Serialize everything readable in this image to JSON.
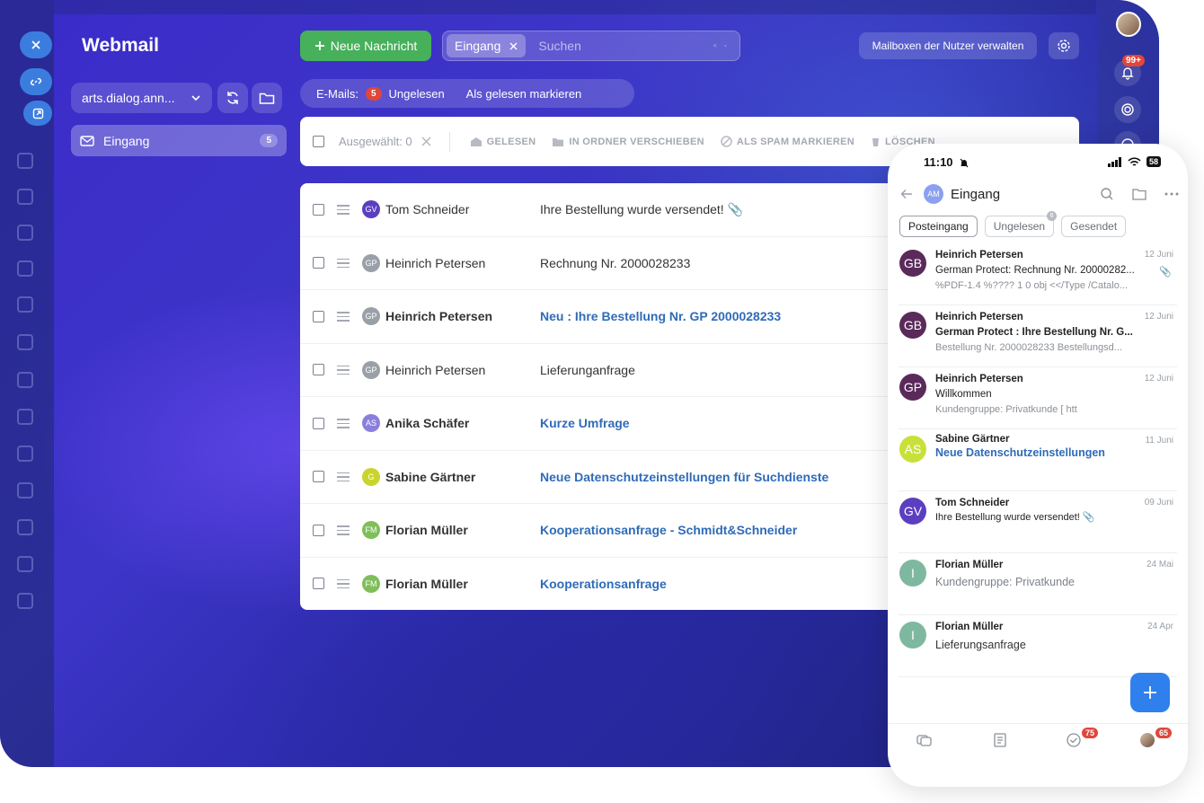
{
  "app": {
    "title": "Webmail"
  },
  "sidebar": {
    "mailbox_selector": "arts.dialog.ann...",
    "folders": [
      {
        "label": "Eingang",
        "count": "5"
      }
    ]
  },
  "header": {
    "new_message": "Neue Nachricht",
    "search_tag": "Eingang",
    "search_placeholder": "Suchen",
    "manage_mailboxes": "Mailboxen der Nutzer verwalten",
    "notifications_badge": "99+"
  },
  "filter": {
    "emails_label": "E-Mails:",
    "unread_count": "5",
    "unread_label": "Ungelesen",
    "mark_all_read": "Als gelesen markieren"
  },
  "toolbar": {
    "selected": "Ausgewählt: 0",
    "read": "GELESEN",
    "move": "IN ORDNER VERSCHIEBEN",
    "spam": "ALS SPAM MARKIEREN",
    "delete": "LÖSCHEN"
  },
  "messages": [
    {
      "initials": "GV",
      "avatar_color": "#5b3fc0",
      "sender": "Tom Schneider",
      "subject": "Ihre Bestellung wurde versendet!",
      "unread": false,
      "attachment": true,
      "inline_clip": true
    },
    {
      "initials": "GP",
      "avatar_color": "#9aa0a8",
      "sender": "Heinrich Petersen",
      "subject": "Rechnung Nr. 2000028233",
      "unread": false,
      "attachment": true,
      "inline_clip": false
    },
    {
      "initials": "GP",
      "avatar_color": "#9aa0a8",
      "sender": "Heinrich Petersen",
      "subject": "Neu : Ihre Bestellung Nr. GP 2000028233",
      "unread": true,
      "attachment": false
    },
    {
      "initials": "GP",
      "avatar_color": "#9aa0a8",
      "sender": "Heinrich Petersen",
      "subject": "Lieferunganfrage",
      "unread": false,
      "attachment": false
    },
    {
      "initials": "AS",
      "avatar_color": "#8a7fdc",
      "sender": "Anika Schäfer",
      "subject": "Kurze Umfrage",
      "unread": true,
      "attachment": false
    },
    {
      "initials": "G",
      "avatar_color": "#c9d42f",
      "sender": "Sabine Gärtner",
      "subject": "Neue Datenschutzeinstellungen für Suchdienste",
      "unread": true,
      "attachment": false
    },
    {
      "initials": "FM",
      "avatar_color": "#7fbf5a",
      "sender": "Florian Müller",
      "subject": "Kooperationsanfrage - Schmidt&Schneider",
      "unread": true,
      "attachment": false
    },
    {
      "initials": "FM",
      "avatar_color": "#7fbf5a",
      "sender": "Florian Müller",
      "subject": "Kooperationsanfrage",
      "unread": true,
      "attachment": false
    }
  ],
  "phone": {
    "time": "11:10",
    "battery": "58",
    "folder_initials": "AM",
    "folder": "Eingang",
    "tabs": [
      {
        "label": "Posteingang",
        "badge": ""
      },
      {
        "label": "Ungelesen",
        "badge": "6"
      },
      {
        "label": "Gesendet",
        "badge": ""
      }
    ],
    "messages": [
      {
        "initials": "GB",
        "color": "#5a2a5a",
        "from": "Heinrich Petersen",
        "date": "12 Juni",
        "subject": "German Protect: Rechnung Nr. 20000282...",
        "preview": "%PDF-1.4 %???? 1 0 obj <</Type /Catalo...",
        "style": "normal",
        "clip": true
      },
      {
        "initials": "GB",
        "color": "#5a2a5a",
        "from": "Heinrich Petersen",
        "date": "12 Juni",
        "subject": "German Protect : Ihre Bestellung Nr. G...",
        "preview": "Bestellung Nr. 2000028233 Bestellungsd...",
        "style": "bold",
        "clip": false
      },
      {
        "initials": "GP",
        "color": "#5a2a5a",
        "from": "Heinrich Petersen",
        "date": "12 Juni",
        "subject": "Willkommen",
        "preview": "Kundengruppe: Privatkunde [ htt",
        "style": "normal",
        "clip": false
      },
      {
        "initials": "AS",
        "color": "#c9e03a",
        "from": "Sabine Gärtner",
        "date": "11 Juni",
        "subject": "Neue Datenschutzeinstellungen",
        "preview": "",
        "style": "blue",
        "clip": false
      },
      {
        "initials": "GV",
        "color": "#5b3fc0",
        "from": "Tom Schneider",
        "date": "09 Juni",
        "subject": "Ihre Bestellung wurde versendet! 📎",
        "preview": "",
        "style": "small",
        "clip": false
      },
      {
        "initials": "I",
        "color": "#7fb8a0",
        "from": "Florian Müller",
        "date": "24 Mai",
        "subject": "Kundengruppe: Privatkunde",
        "preview": "",
        "style": "plain-gray",
        "clip": false
      },
      {
        "initials": "I",
        "color": "#7fb8a0",
        "from": "Florian Müller",
        "date": "24 Apr",
        "subject": "Lieferungsanfrage",
        "preview": "",
        "style": "plain",
        "clip": false
      }
    ],
    "nav_badges": [
      "75",
      "65"
    ]
  },
  "colors": {
    "accent": "#2f80ed",
    "green": "#47b05b",
    "badge_red": "#e0463a",
    "unread_blue": "#2f6bb8"
  }
}
